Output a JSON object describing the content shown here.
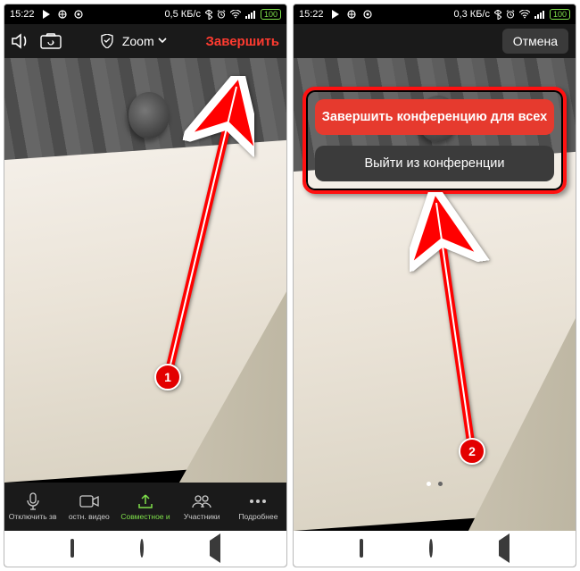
{
  "status": {
    "time": "15:22",
    "data_rate_left": "0,5 КБ/с",
    "data_rate_right": "0,3 КБ/с",
    "battery": "100"
  },
  "left": {
    "zoom_label": "Zoom",
    "end_label": "Завершить",
    "footer": {
      "mute": "Отключить зв",
      "stop_video": "остн. видео",
      "share": "Совместное и",
      "participants": "Участники",
      "more": "Подробнее"
    },
    "badge": "1"
  },
  "right": {
    "cancel_label": "Отмена",
    "end_for_all": "Завершить конференцию для всех",
    "leave": "Выйти из конференции",
    "badge": "2"
  }
}
